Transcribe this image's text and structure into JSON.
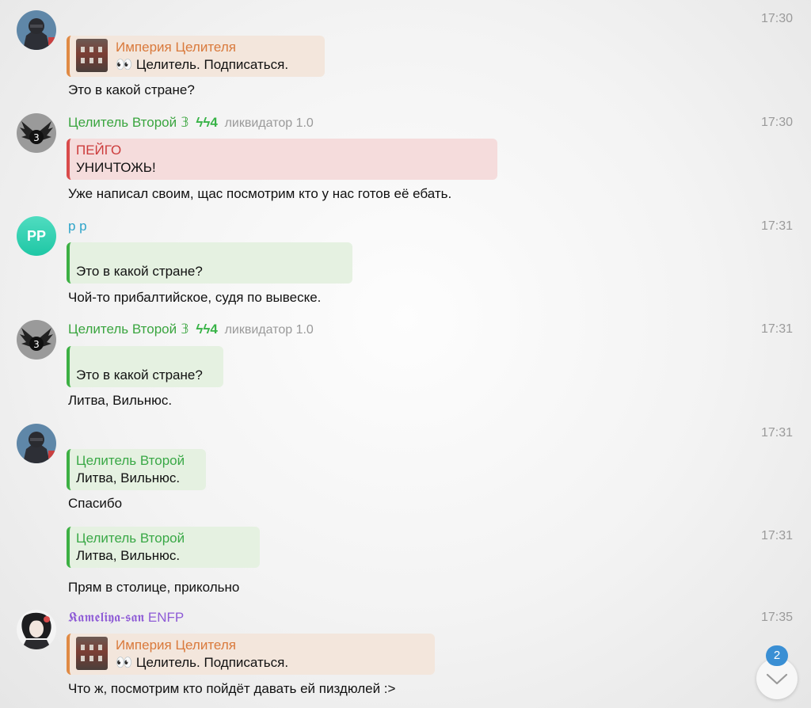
{
  "messages": [
    {
      "time": "17:30",
      "quote": {
        "title": "Империя Целителя",
        "text": "👀  Целитель. Подписаться."
      },
      "text": "Это в какой стране?"
    },
    {
      "sender": "Целитель Второй",
      "sender_emoji": "𝟛",
      "sender_badge": "ϟϟ4",
      "sender_role": "ликвидатор 1.0",
      "time": "17:30",
      "quote": {
        "title": "ПЕЙГО",
        "text": "УНИЧТОЖЬ!"
      },
      "text": "Уже написал своим, щас посмотрим кто у нас готов её ебать."
    },
    {
      "sender": "p p",
      "avatar_initials": "PP",
      "time": "17:31",
      "quote": {
        "title": "",
        "text": "Это в какой стране?"
      },
      "text": "Чой-то прибалтийское, судя по вывеске."
    },
    {
      "sender": "Целитель Второй",
      "sender_emoji": "𝟛",
      "sender_badge": "ϟϟ4",
      "sender_role": "ликвидатор 1.0",
      "time": "17:31",
      "quote": {
        "title": "",
        "text": "Это в какой стране?"
      },
      "text": "Литва, Вильнюс."
    },
    {
      "time": "17:31",
      "quote": {
        "title": "Целитель Второй",
        "text": "Литва, Вильнюс."
      },
      "text": "Спасибо"
    },
    {
      "time": "17:31",
      "quote": {
        "title": "Целитель Второй",
        "text": "Литва, Вильнюс."
      },
      "text": "Прям в столице, прикольно"
    },
    {
      "sender": "𝕶𝖆𝖒𝖊𝖑𝖎𝖞𝖆-𝖘𝖆𝖓 ENFP",
      "time": "17:35",
      "quote": {
        "title": "Империя Целителя",
        "text": "👀  Целитель. Подписаться."
      },
      "text": "Что ж, посмотрим кто пойдёт давать ей пиздюлей :>"
    }
  ],
  "scroll_badge": "2",
  "colors": {
    "green_sender": "#3aa53f",
    "pp_sender": "#2da4c9",
    "purple_sender": "#8e5bd6",
    "orange_quote": "#d9793b",
    "red_quote": "#cc3b3b"
  },
  "icons": [
    "avatar-knight",
    "avatar-winged-logo",
    "avatar-anime",
    "chevron-down-icon",
    "image-thumbnail"
  ]
}
